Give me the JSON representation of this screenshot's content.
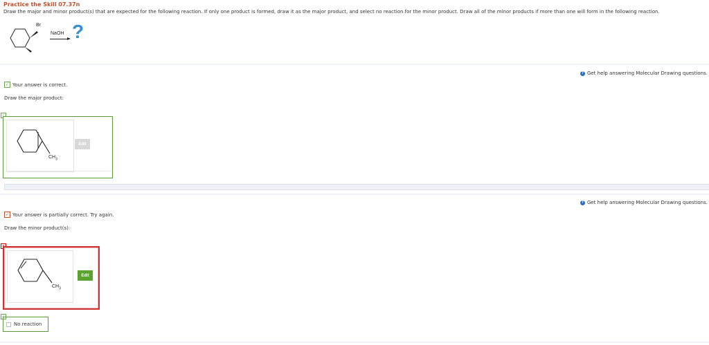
{
  "header": {
    "title": "Practice the Skill 07.37n",
    "instructions": "Draw the major and minor product(s) that are expected for the following reaction. If only one product is formed, draw it as the major product, and select no reaction for the minor product. Draw all of the minor products if more than one will form in the following reaction."
  },
  "reaction": {
    "substituent_label": "Br",
    "reagent": "NaOH",
    "product_placeholder": "?"
  },
  "major_section": {
    "help_link": "Get help answering Molecular Drawing questions.",
    "status": "Your answer is correct.",
    "prompt": "Draw the major product:",
    "edit_label": "Edit",
    "methyl_label": "CH",
    "methyl_sub": "3",
    "status_mark": "✓",
    "corner_mark": "✓"
  },
  "minor_section": {
    "help_link": "Get help answering Molecular Drawing questions.",
    "status": "Your answer is partially correct.  Try again.",
    "prompt": "Draw the minor product(s):",
    "edit_label": "Edit",
    "methyl_label": "CH",
    "methyl_sub": "3",
    "status_mark": "✓",
    "corner_mark": "✕",
    "no_reaction_mark": "✓",
    "no_reaction_label": "No reaction"
  },
  "icons": {
    "help": "help-circle-icon",
    "check": "checkmark-icon",
    "wrong": "x-mark-icon"
  },
  "colors": {
    "title": "#c0502a",
    "correct": "#5c9a3c",
    "incorrect": "#cc3333",
    "edit_active": "#5aa32f",
    "help_icon": "#2d6fb3",
    "question_mark": "#3a8fd4"
  }
}
